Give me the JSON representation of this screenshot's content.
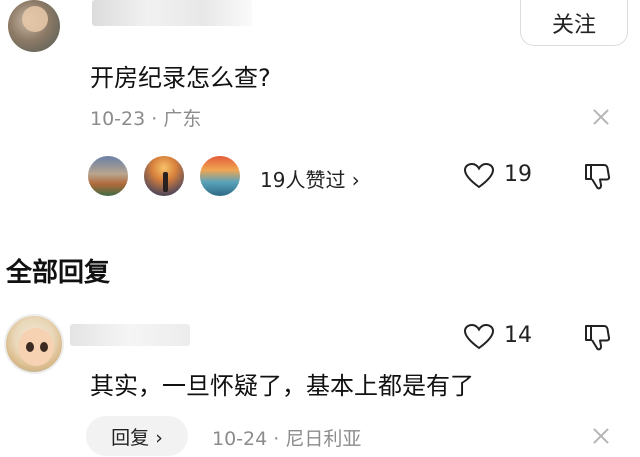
{
  "comment": {
    "follow_label": "关注",
    "text": "开房纪录怎么查?",
    "meta": "10-23 · 广东",
    "likes_text": "19人赞过 ›",
    "like_count": "19"
  },
  "section_title": "全部回复",
  "reply": {
    "text": "其实，一旦怀疑了，基本上都是有了",
    "like_count": "14",
    "reply_button": "回复 ›",
    "meta": "10-24 · 尼日利亚"
  },
  "icons": {
    "heart": "heart-icon",
    "dislike": "thumbs-down-icon",
    "close": "close-icon"
  }
}
